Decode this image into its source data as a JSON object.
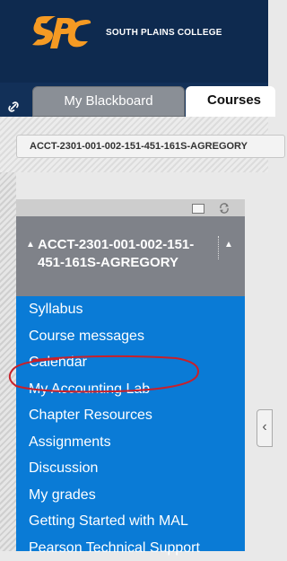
{
  "header": {
    "brand_text": "SOUTH PLAINS COLLEGE",
    "logo_icon": "spc-logo-icon",
    "bg_color": "#0e2a4f",
    "logo_color": "#f59a23"
  },
  "tabs": [
    {
      "label": "My Blackboard",
      "active": false
    },
    {
      "label": "Courses",
      "active": true
    }
  ],
  "breadcrumb": {
    "text": "ACCT-2301-001-002-151-451-161S-AGREGORY"
  },
  "course_menu": {
    "title": "ACCT-2301-001-002-151-451-161S-AGREGORY",
    "items": [
      {
        "label": "Syllabus"
      },
      {
        "label": "Course messages"
      },
      {
        "label": "Calendar"
      },
      {
        "label": "My Accounting Lab"
      },
      {
        "label": "Chapter Resources"
      },
      {
        "label": "Assignments"
      },
      {
        "label": "Discussion"
      },
      {
        "label": "My grades"
      },
      {
        "label": "Getting Started with MAL"
      },
      {
        "label": "Pearson Technical Support"
      }
    ],
    "menu_color": "#0a7bd6",
    "title_color": "#7f8289"
  },
  "annotation": {
    "color": "#c8202a",
    "target": "My Accounting Lab"
  }
}
